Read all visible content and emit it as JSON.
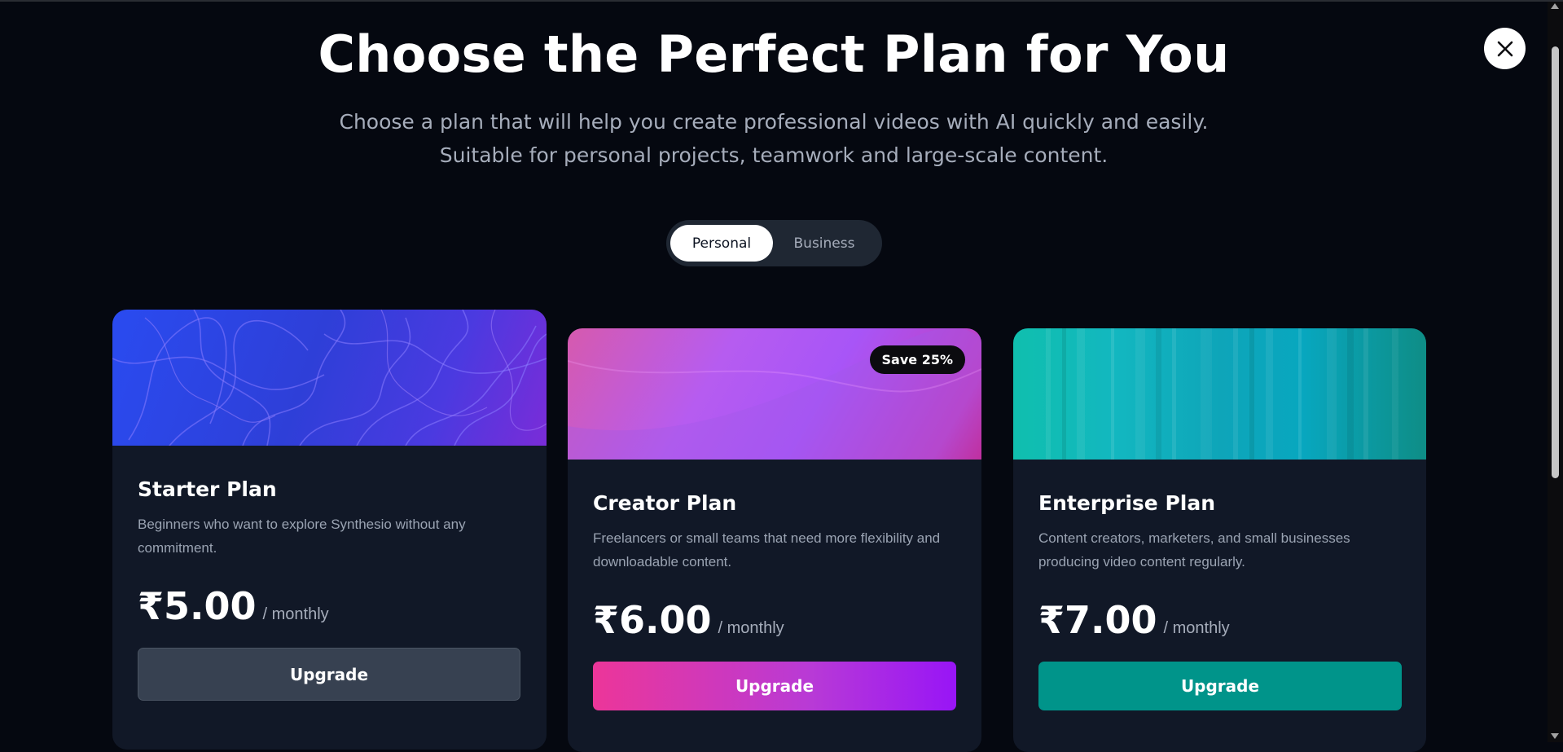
{
  "header": {
    "title": "Choose the Perfect Plan for You",
    "subtitle_line1": "Choose a plan that will help you create professional videos with AI quickly and easily.",
    "subtitle_line2": "Suitable for personal projects, teamwork and large-scale content."
  },
  "close_icon": "close-icon",
  "toggle": {
    "options": [
      "Personal",
      "Business"
    ],
    "selected": "Personal"
  },
  "plans": [
    {
      "name": "Starter Plan",
      "description": "Beginners who want to explore Synthesio without any commitment.",
      "price": "₹5.00",
      "period": "/ monthly",
      "button": "Upgrade",
      "accent": "#374151"
    },
    {
      "name": "Creator Plan",
      "badge": "Save 25%",
      "description": "Freelancers or small teams that need more flexibility and downloadable content.",
      "price": "₹6.00",
      "period": "/ monthly",
      "button": "Upgrade",
      "accent": "#ec3699"
    },
    {
      "name": "Enterprise Plan",
      "description": "Content creators, marketers, and small businesses producing video content regularly.",
      "price": "₹7.00",
      "period": "/ monthly",
      "button": "Upgrade",
      "accent": "#00948a"
    }
  ]
}
